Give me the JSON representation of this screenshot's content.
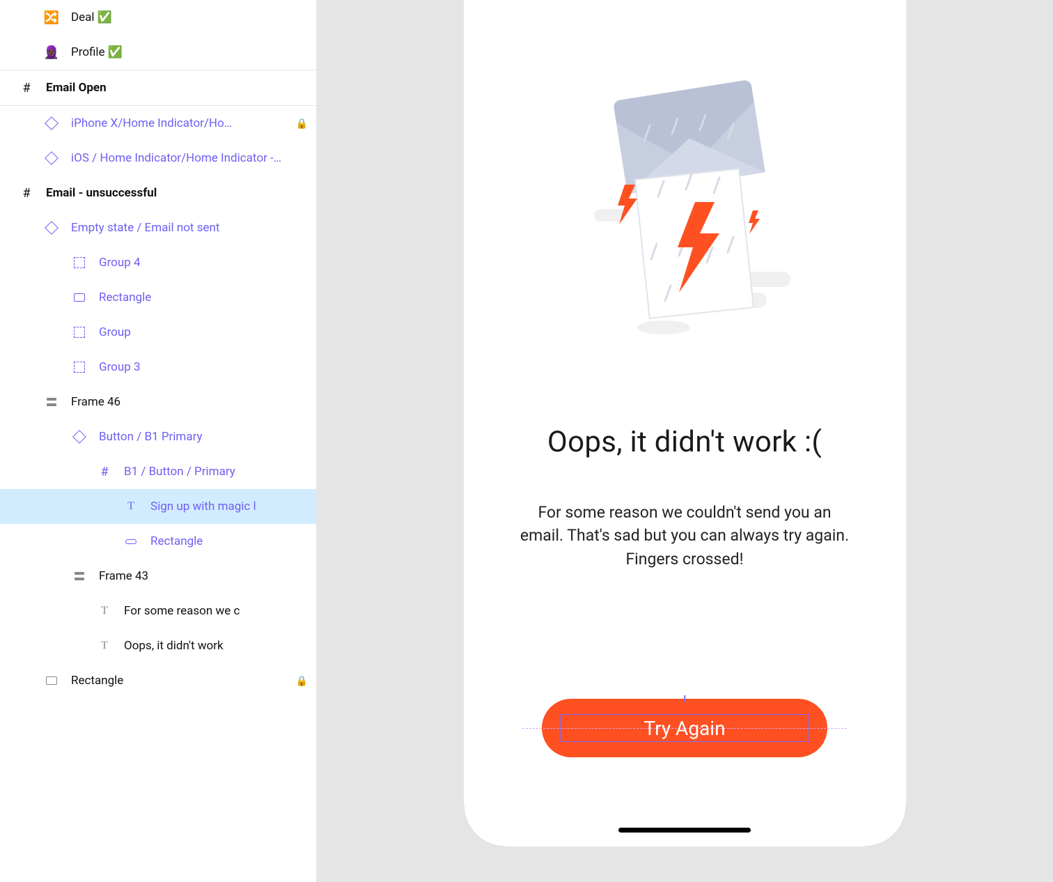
{
  "layers": {
    "deal": "Deal ✅",
    "profile": "Profile ✅",
    "email_open": "Email Open",
    "iphone_hi": "iPhone X/Home Indicator/Ho…",
    "ios_hi": "iOS / Home Indicator/Home Indicator -…",
    "email_unsuccessful": "Email - unsuccessful",
    "empty_state": "Empty state / Email not sent",
    "group4": "Group 4",
    "rectangle": "Rectangle",
    "group": "Group",
    "group3": "Group 3",
    "frame46": "Frame 46",
    "button_b1": "Button / B1 Primary",
    "b1_button_primary": "B1 / Button / Primary",
    "signup_magic": "Sign up with magic l",
    "rectangle2": "Rectangle",
    "frame43": "Frame 43",
    "for_some_reason": "For some reason we c",
    "oops_didnt_work": "Oops, it didn't work",
    "rectangle3": "Rectangle"
  },
  "preview": {
    "headline": "Oops, it didn't work :(",
    "subtext": "For some reason we couldn't send you an email. That's sad but you can always try again. Fingers crossed!",
    "cta": "Try Again"
  },
  "colors": {
    "accent": "#ff5022",
    "purple": "#6f5ff2"
  }
}
